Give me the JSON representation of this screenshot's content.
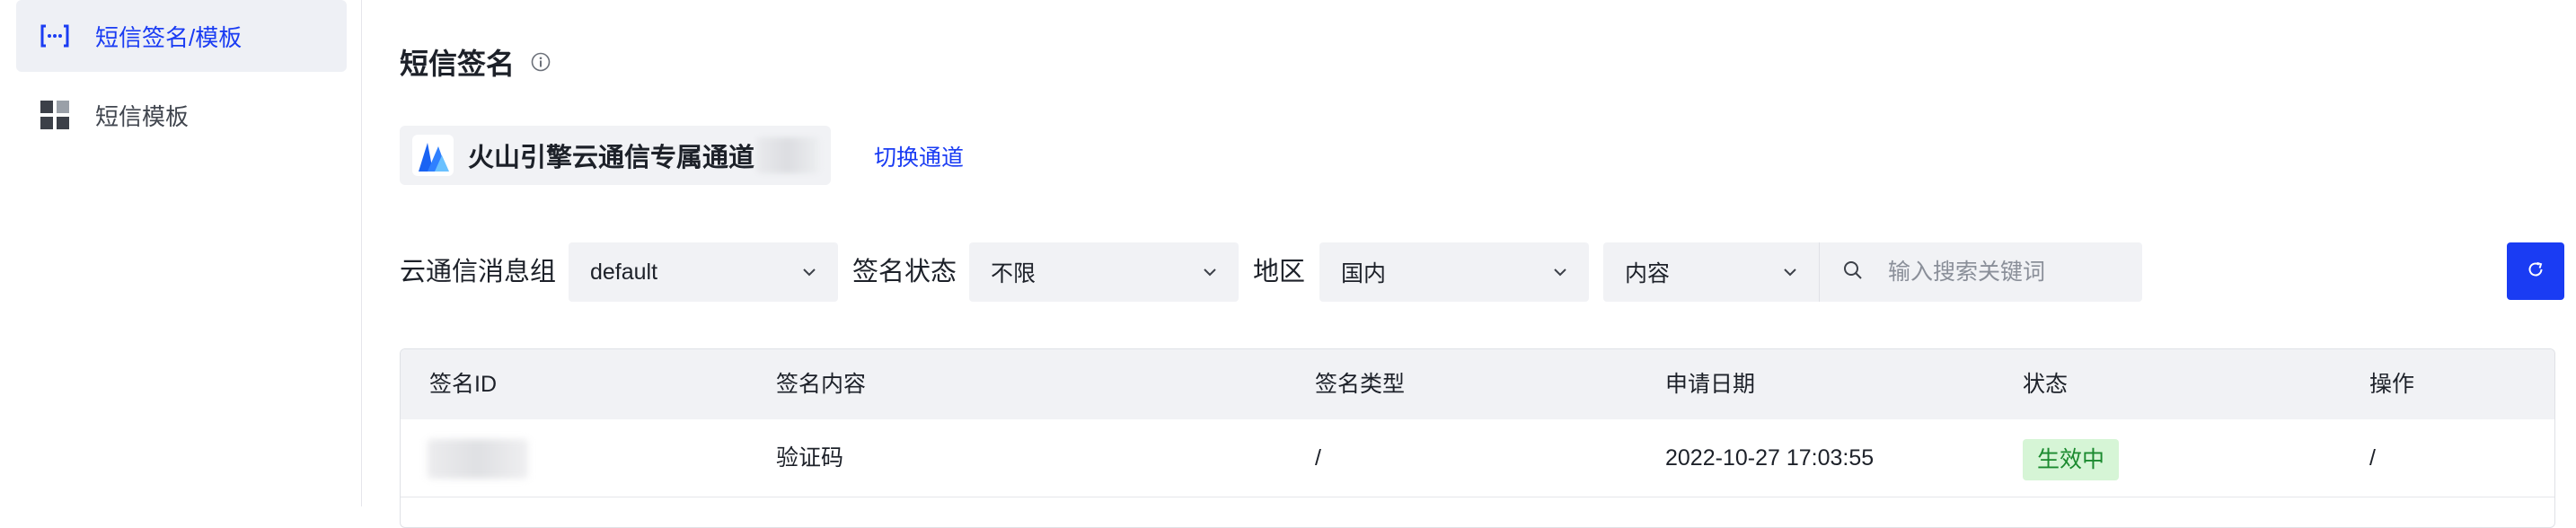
{
  "sidebar": {
    "items": [
      {
        "label": "短信签名/模板",
        "icon": "brackets-icon",
        "active": true
      },
      {
        "label": "短信模板",
        "icon": "grid-icon",
        "active": false
      }
    ]
  },
  "page": {
    "title": "短信签名",
    "info_icon": "info-icon"
  },
  "channel": {
    "name": "火山引擎云通信专属通道",
    "switch_label": "切换通道"
  },
  "filters": {
    "group_label": "云通信消息组",
    "group_value": "default",
    "status_label": "签名状态",
    "status_value": "不限",
    "region_label": "地区",
    "region_value": "国内",
    "search_field_value": "内容",
    "search_placeholder": "输入搜索关键词"
  },
  "table": {
    "columns": [
      "签名ID",
      "签名内容",
      "签名类型",
      "申请日期",
      "状态",
      "操作"
    ],
    "rows": [
      {
        "id": "",
        "content": "验证码",
        "type": "/",
        "date": "2022-10-27 17:03:55",
        "status": "生效中",
        "action": "/"
      }
    ]
  },
  "colors": {
    "accent": "#1a3cf3",
    "status_active_bg": "#d6f5d6",
    "status_active_text": "#1b8a2f"
  }
}
